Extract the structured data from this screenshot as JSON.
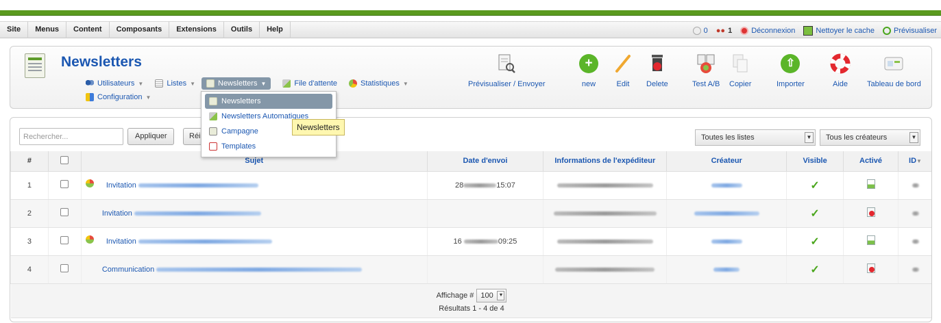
{
  "menubar": {
    "items": [
      "Site",
      "Menus",
      "Content",
      "Composants",
      "Extensions",
      "Outils",
      "Help"
    ],
    "status": {
      "visitors": "0",
      "users": "1",
      "logout": "Déconnexion",
      "clear_cache": "Nettoyer le cache",
      "preview": "Prévisualiser"
    }
  },
  "header": {
    "title": "Newsletters",
    "subnav": [
      {
        "label": "Utilisateurs",
        "icon": "users-icon"
      },
      {
        "label": "Listes",
        "icon": "lists-icon"
      },
      {
        "label": "Newsletters",
        "icon": "newsletter-icon",
        "active": true
      },
      {
        "label": "File d'attente",
        "icon": "queue-icon"
      },
      {
        "label": "Statistiques",
        "icon": "stats-icon"
      }
    ],
    "configuration": "Configuration"
  },
  "toolbar": {
    "preview_send": "Prévisualiser / Envoyer",
    "new": "new",
    "edit": "Edit",
    "delete": "Delete",
    "test_ab": "Test A/B",
    "copy": "Copier",
    "import": "Importer",
    "help": "Aide",
    "dashboard": "Tableau de bord"
  },
  "dropdown": {
    "items": [
      "Newsletters",
      "Newsletters Automatiques",
      "Campagne",
      "Templates"
    ],
    "tooltip": "Newsletters"
  },
  "filters": {
    "search_placeholder": "Rechercher...",
    "apply": "Appliquer",
    "reset": "Réi",
    "lists_select": "Toutes les listes",
    "creators_select": "Tous les créateurs"
  },
  "table": {
    "headers": {
      "num": "#",
      "subject": "Sujet",
      "send_date": "Date d'envoi",
      "sender_info": "Informations de l'expéditeur",
      "creator": "Créateur",
      "visible": "Visible",
      "active": "Activé",
      "id": "ID"
    },
    "rows": [
      {
        "num": "1",
        "subject": "Invitation",
        "date_start": "28",
        "date_end": "15:07",
        "sent": true,
        "activated": true
      },
      {
        "num": "2",
        "subject": "Invitation",
        "date_start": "",
        "date_end": "",
        "sent": false,
        "activated": false
      },
      {
        "num": "3",
        "subject": "Invitation",
        "date_start": "16",
        "date_end": "09:25",
        "sent": true,
        "activated": true
      },
      {
        "num": "4",
        "subject": "Communication",
        "date_start": "",
        "date_end": "",
        "sent": false,
        "activated": false
      }
    ]
  },
  "pagination": {
    "display_label": "Affichage #",
    "per_page": "100",
    "results": "Résultats 1 - 4 de 4"
  },
  "colors": {
    "brand_green": "#5a9a1e",
    "link_blue": "#1b57b1",
    "active_tab": "#8497a8"
  }
}
